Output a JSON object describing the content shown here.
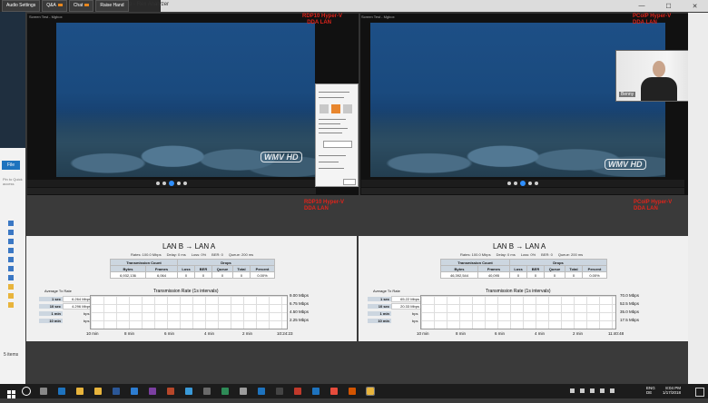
{
  "toolbar": {
    "audio_settings": "Audio Settings",
    "qa": "Q&A",
    "chat": "Chat",
    "raise_hand": "Raise Hand"
  },
  "window": {
    "title": "Rex Analyzer",
    "title_prefix": "p -"
  },
  "left_panel": {
    "tab": "File",
    "hint": "Pin to Quick access",
    "footer": "5 items"
  },
  "video_left": {
    "title": "Screen Test - Mgbox",
    "overlay_line1": "RDP10 Hyper-V",
    "overlay_line2": "DDA LAN",
    "watermark": "WMV HD"
  },
  "video_right": {
    "title": "Screen Test - Mgbox",
    "overlay_line1": "PCoIP Hyper-V",
    "overlay_line2": "DDA LAN",
    "watermark": "WMV HD"
  },
  "webcam": {
    "name": "Benny"
  },
  "panel_labels": {
    "left_line1": "RDP10 Hyper-V",
    "left_line2": "DDA LAN",
    "right_line1": "PCoIP Hyper-V",
    "right_line2": "DDA LAN"
  },
  "stats_left": {
    "title": "LAN B → LAN A",
    "info": {
      "rates": "Rates: 100.0 Mbps",
      "delay": "Delay: 0 ms",
      "loss": "Loss: 0%",
      "ber": "BER: 0",
      "queue": "Queue: 200 ms"
    },
    "transmission_count_header": "Transmission Count",
    "drops_header": "Drops",
    "columns": [
      "Bytes",
      "Frames",
      "Loss",
      "BER",
      "Queue",
      "Total",
      "Percent"
    ],
    "row": [
      "6,932,136",
      "6,064",
      "0",
      "0",
      "0",
      "0",
      "0.00%"
    ],
    "avg_title": "Average Tx Rate",
    "avg_rows": [
      {
        "label": "1 sec",
        "value": "6.264 Mbps",
        "unit": ""
      },
      {
        "label": "10 sec",
        "value": "4.296 Mbps",
        "unit": ""
      },
      {
        "label": "1 min",
        "value": "",
        "unit": "bps"
      },
      {
        "label": "10 min",
        "value": "",
        "unit": "bps"
      }
    ],
    "graph_title": "Transmission Rate (1s intervals)",
    "y_ticks": [
      "9.00 Mbps",
      "6.75 Mbps",
      "4.50 Mbps",
      "2.25 Mbps"
    ],
    "x_ticks": [
      "10 min",
      "8 min",
      "6 min",
      "4 min",
      "2 min",
      "10:24:23"
    ]
  },
  "stats_right": {
    "title": "LAN B → LAN A",
    "info": {
      "rates": "Rates: 100.0 Mbps",
      "delay": "Delay: 0 ms",
      "loss": "Loss: 0%",
      "ber": "BER: 0",
      "queue": "Queue: 200 ms"
    },
    "transmission_count_header": "Transmission Count",
    "drops_header": "Drops",
    "columns": [
      "Bytes",
      "Frames",
      "Loss",
      "BER",
      "Queue",
      "Total",
      "Percent"
    ],
    "row": [
      "46,392,544",
      "40,095",
      "0",
      "0",
      "0",
      "0",
      "0.00%"
    ],
    "avg_title": "Average Tx Rate",
    "avg_rows": [
      {
        "label": "1 sec",
        "value": "65.22 Mbps",
        "unit": ""
      },
      {
        "label": "10 sec",
        "value": "20.33 Mbps",
        "unit": ""
      },
      {
        "label": "1 min",
        "value": "",
        "unit": "bps"
      },
      {
        "label": "10 min",
        "value": "",
        "unit": "bps"
      }
    ],
    "graph_title": "Transmission Rate (1s intervals)",
    "y_ticks": [
      "70.0 Mbps",
      "52.5 Mbps",
      "35.0 Mbps",
      "17.5 Mbps"
    ],
    "x_ticks": [
      "10 min",
      "8 min",
      "6 min",
      "4 min",
      "2 min",
      "11:40:48"
    ]
  },
  "taskbar": {
    "lang_top": "ENG",
    "lang_bottom": "DE",
    "time": "8:04 PM",
    "date": "1/17/2018"
  }
}
